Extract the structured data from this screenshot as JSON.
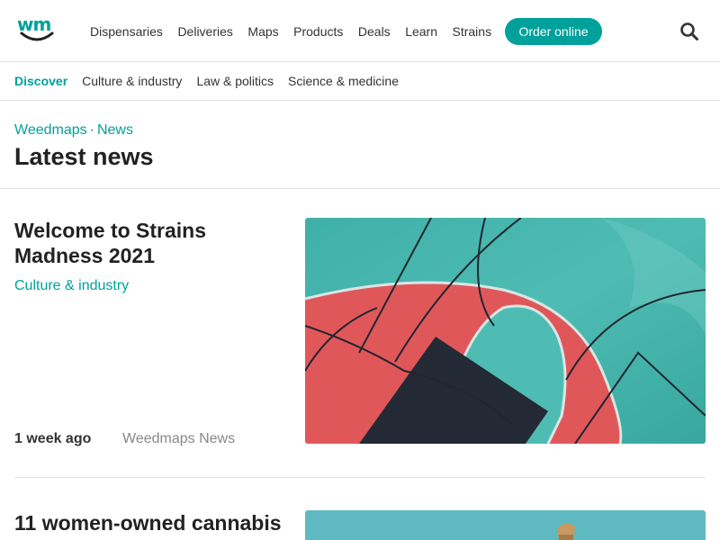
{
  "brand": {
    "logo_text": "wm",
    "accent": "#00a19b"
  },
  "nav": {
    "items": [
      "Dispensaries",
      "Deliveries",
      "Maps",
      "Products",
      "Deals",
      "Learn",
      "Strains"
    ],
    "order_button": "Order online",
    "search_icon": "search-icon"
  },
  "subnav": {
    "items": [
      "Discover",
      "Culture & industry",
      "Law & politics",
      "Science & medicine"
    ],
    "active": "Discover"
  },
  "header": {
    "breadcrumb": [
      "Weedmaps",
      "News"
    ],
    "separator": "·",
    "title": "Latest news"
  },
  "articles": [
    {
      "title": "Welcome to Strains Madness 2021",
      "category": "Culture & industry",
      "time": "1 week ago",
      "author": "Weedmaps News"
    },
    {
      "title": "11 women-owned cannabis"
    }
  ]
}
